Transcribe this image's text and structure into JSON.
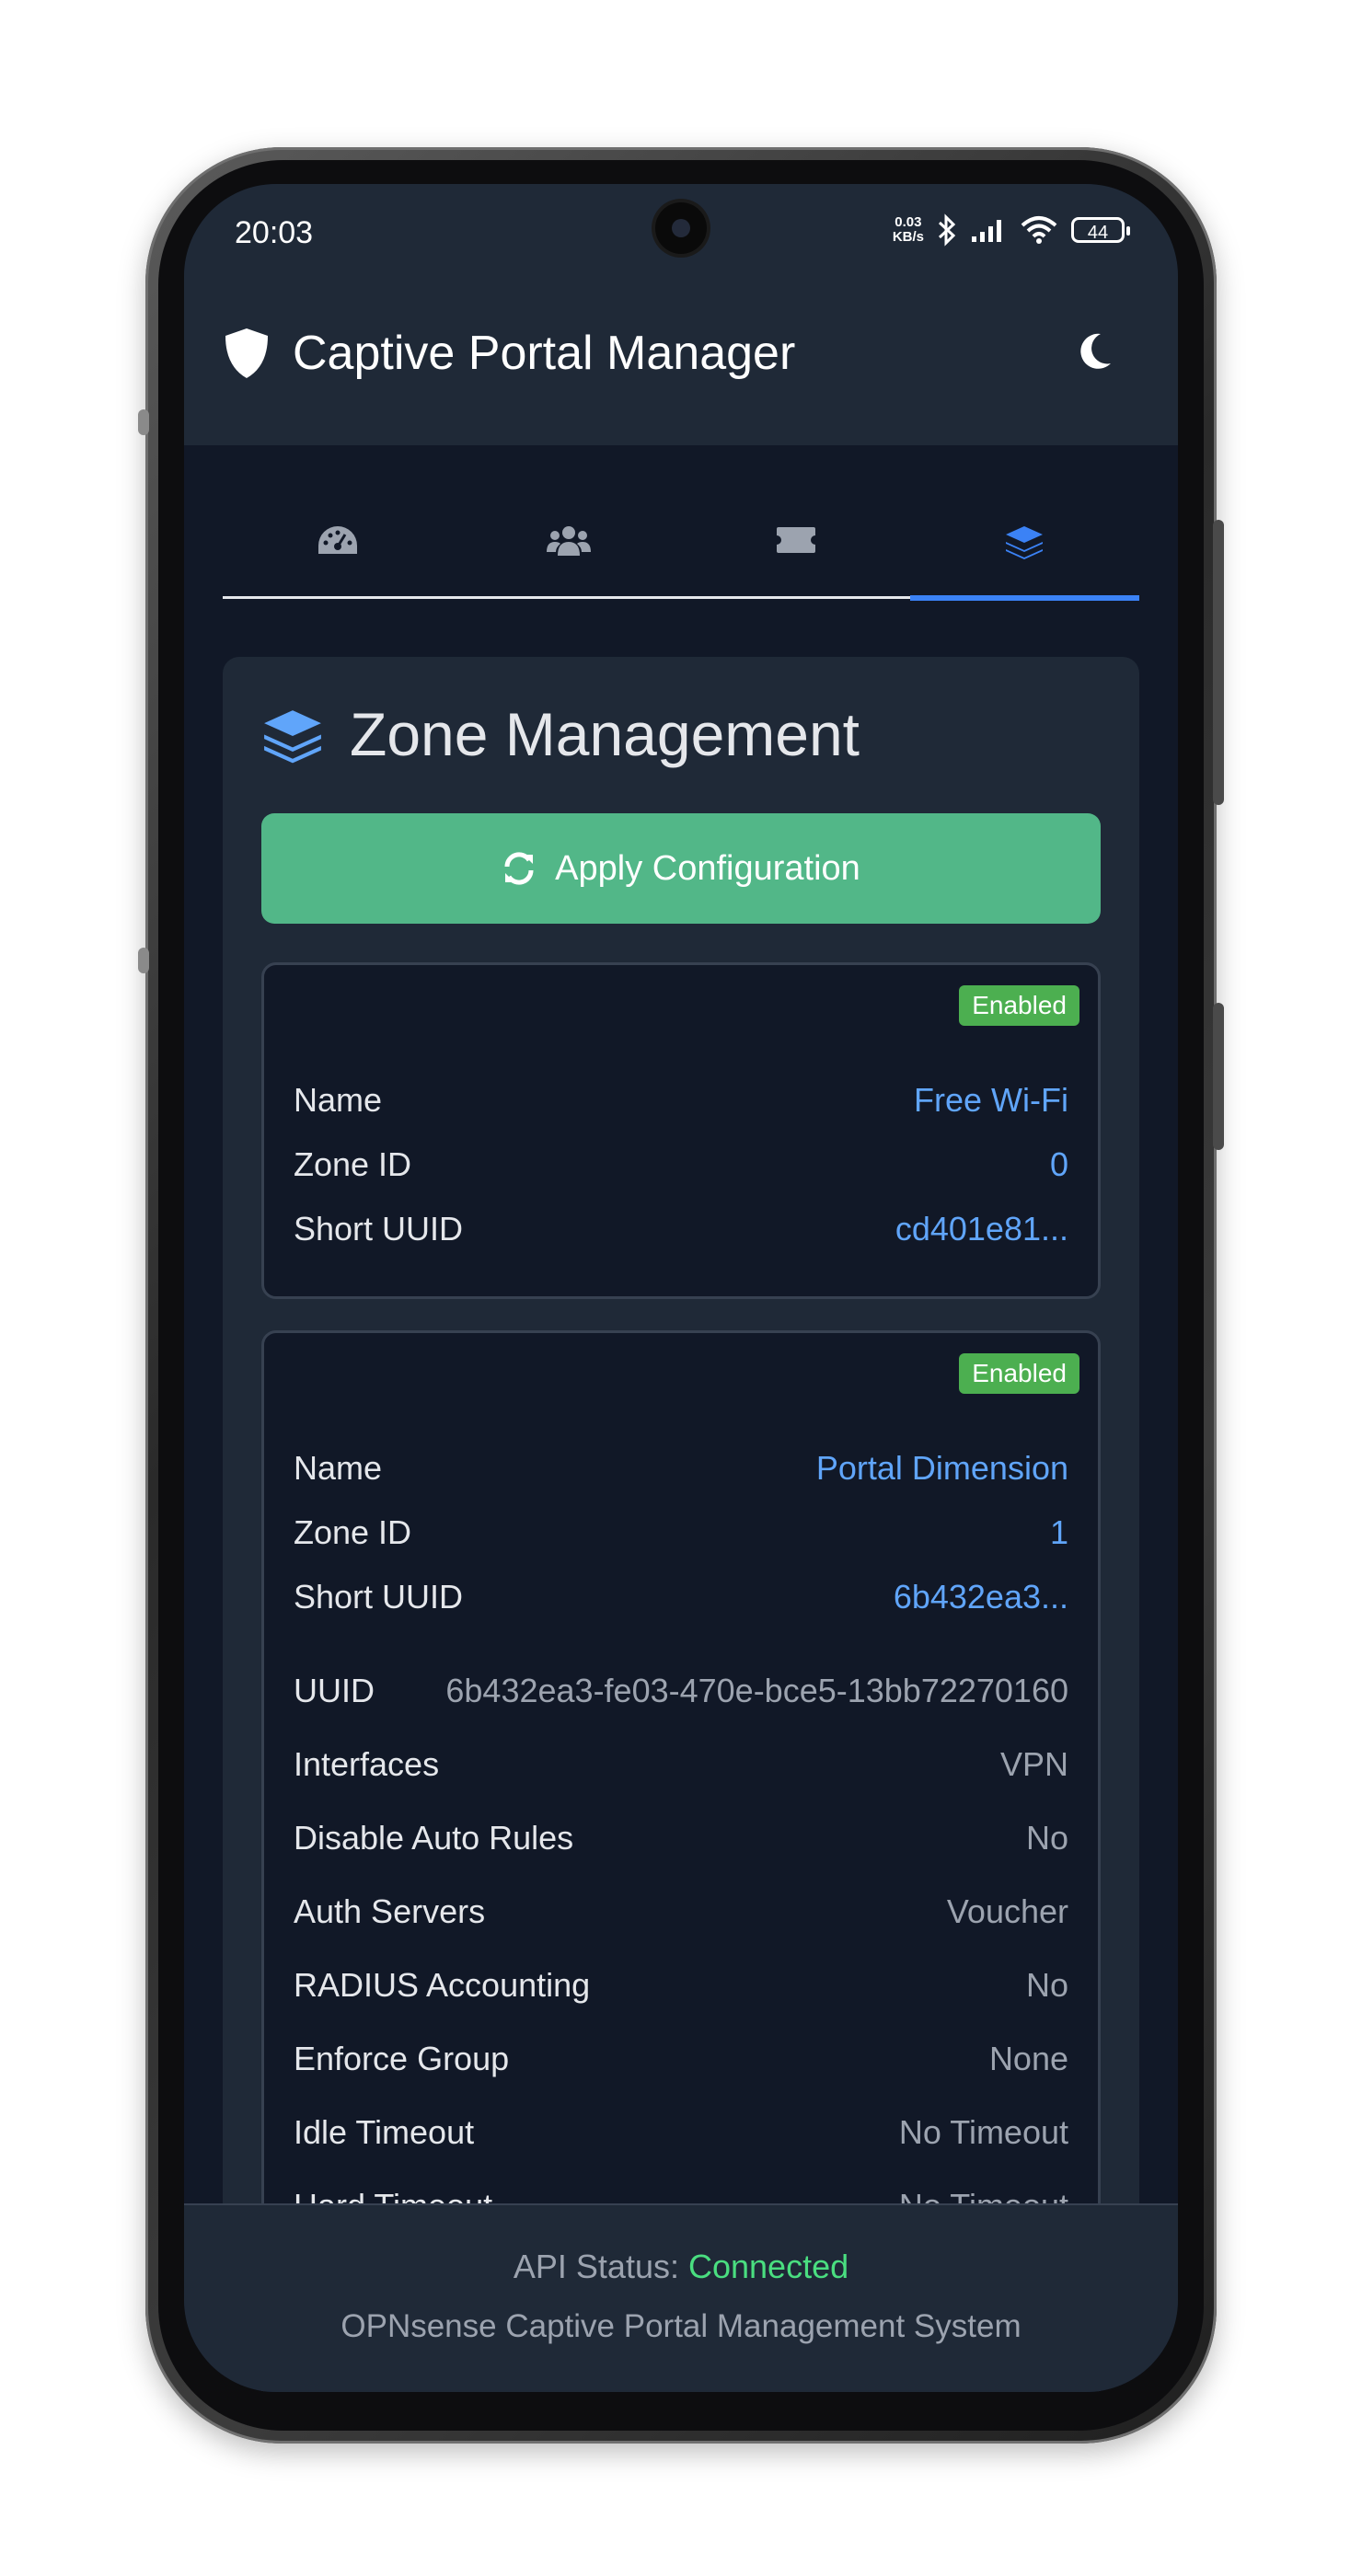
{
  "status_bar": {
    "time": "20:03",
    "net_speed_value": "0.03",
    "net_speed_unit": "KB/s",
    "battery": "44",
    "icons": [
      "bluetooth-icon",
      "signal-icon",
      "wifi-icon",
      "battery-icon"
    ]
  },
  "app": {
    "title": "Captive Portal Manager",
    "logo_icon": "shield-icon",
    "theme_toggle_icon": "moon-icon"
  },
  "tabs": [
    {
      "icon": "tachometer-icon",
      "active": false
    },
    {
      "icon": "users-icon",
      "active": false
    },
    {
      "icon": "ticket-icon",
      "active": false
    },
    {
      "icon": "layers-icon",
      "active": true
    }
  ],
  "colors": {
    "background": "#111827",
    "surface": "#1f2937",
    "accent": "#3b82f6",
    "value_blue": "#60a5fa",
    "button_green": "#52b788",
    "badge_green": "#4caf50",
    "connected_green": "#4ade80"
  },
  "zone_management": {
    "title": "Zone Management",
    "apply_button": "Apply Configuration",
    "zones": [
      {
        "status": "Enabled",
        "name_label": "Name",
        "name": "Free Wi-Fi",
        "zone_id_label": "Zone ID",
        "zone_id": "0",
        "short_uuid_label": "Short UUID",
        "short_uuid": "cd401e81..."
      },
      {
        "status": "Enabled",
        "name_label": "Name",
        "name": "Portal Dimension",
        "zone_id_label": "Zone ID",
        "zone_id": "1",
        "short_uuid_label": "Short UUID",
        "short_uuid": "6b432ea3...",
        "details": [
          {
            "label": "UUID",
            "value": "6b432ea3-fe03-470e-bce5-13bb72270160"
          },
          {
            "label": "Interfaces",
            "value": "VPN"
          },
          {
            "label": "Disable Auto Rules",
            "value": "No"
          },
          {
            "label": "Auth Servers",
            "value": "Voucher"
          },
          {
            "label": "RADIUS Accounting",
            "value": "No"
          },
          {
            "label": "Enforce Group",
            "value": "None"
          },
          {
            "label": "Idle Timeout",
            "value": "No Timeout"
          },
          {
            "label": "Hard Timeout",
            "value": "No Timeout"
          }
        ]
      }
    ]
  },
  "footer": {
    "api_status_label": "API Status:",
    "api_status_value": "Connected",
    "system_name": "OPNsense Captive Portal Management System"
  }
}
